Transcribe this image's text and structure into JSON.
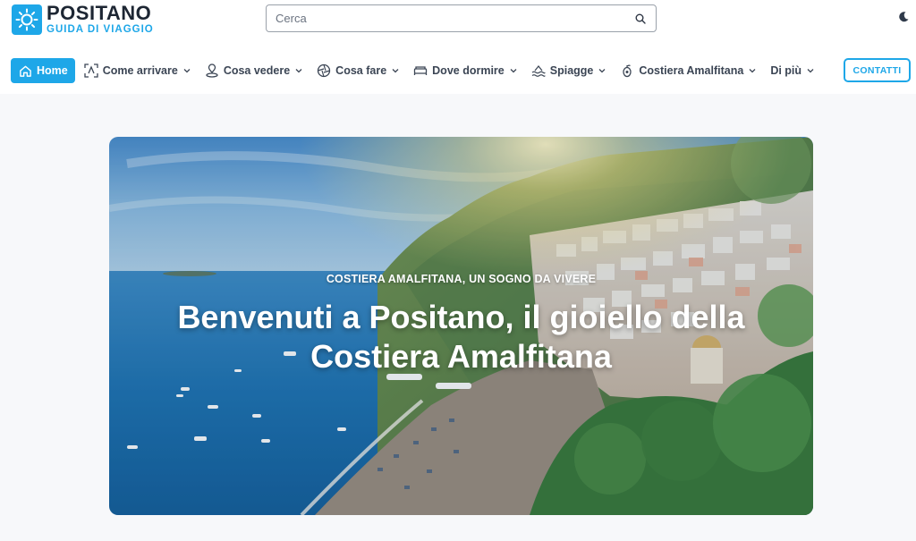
{
  "brand": {
    "title": "POSITANO",
    "subtitle": "GUIDA DI VIAGGIO",
    "accent_color": "#1ea7e8",
    "icon": "sun-icon"
  },
  "search": {
    "placeholder": "Cerca",
    "value": "",
    "icon": "search-icon"
  },
  "theme_toggle": {
    "icon": "moon-icon"
  },
  "nav": {
    "items": [
      {
        "label": "Home",
        "icon": "home-icon",
        "active": true,
        "has_dropdown": false
      },
      {
        "label": "Come arrivare",
        "icon": "directions-icon",
        "active": false,
        "has_dropdown": true
      },
      {
        "label": "Cosa vedere",
        "icon": "map-pin-icon",
        "active": false,
        "has_dropdown": true
      },
      {
        "label": "Cosa fare",
        "icon": "camera-aperture-icon",
        "active": false,
        "has_dropdown": true
      },
      {
        "label": "Dove dormire",
        "icon": "bed-icon",
        "active": false,
        "has_dropdown": true
      },
      {
        "label": "Spiagge",
        "icon": "beach-waves-icon",
        "active": false,
        "has_dropdown": true
      },
      {
        "label": "Costiera Amalfitana",
        "icon": "lemon-icon",
        "active": false,
        "has_dropdown": true
      },
      {
        "label": "Di più",
        "icon": "",
        "active": false,
        "has_dropdown": true
      }
    ],
    "contact_label": "CONTATTI"
  },
  "hero": {
    "kicker": "COSTIERA AMALFITANA, UN SOGNO DA VIVERE",
    "title": "Benvenuti a Positano, il gioiello della Costiera Amalfitana"
  }
}
